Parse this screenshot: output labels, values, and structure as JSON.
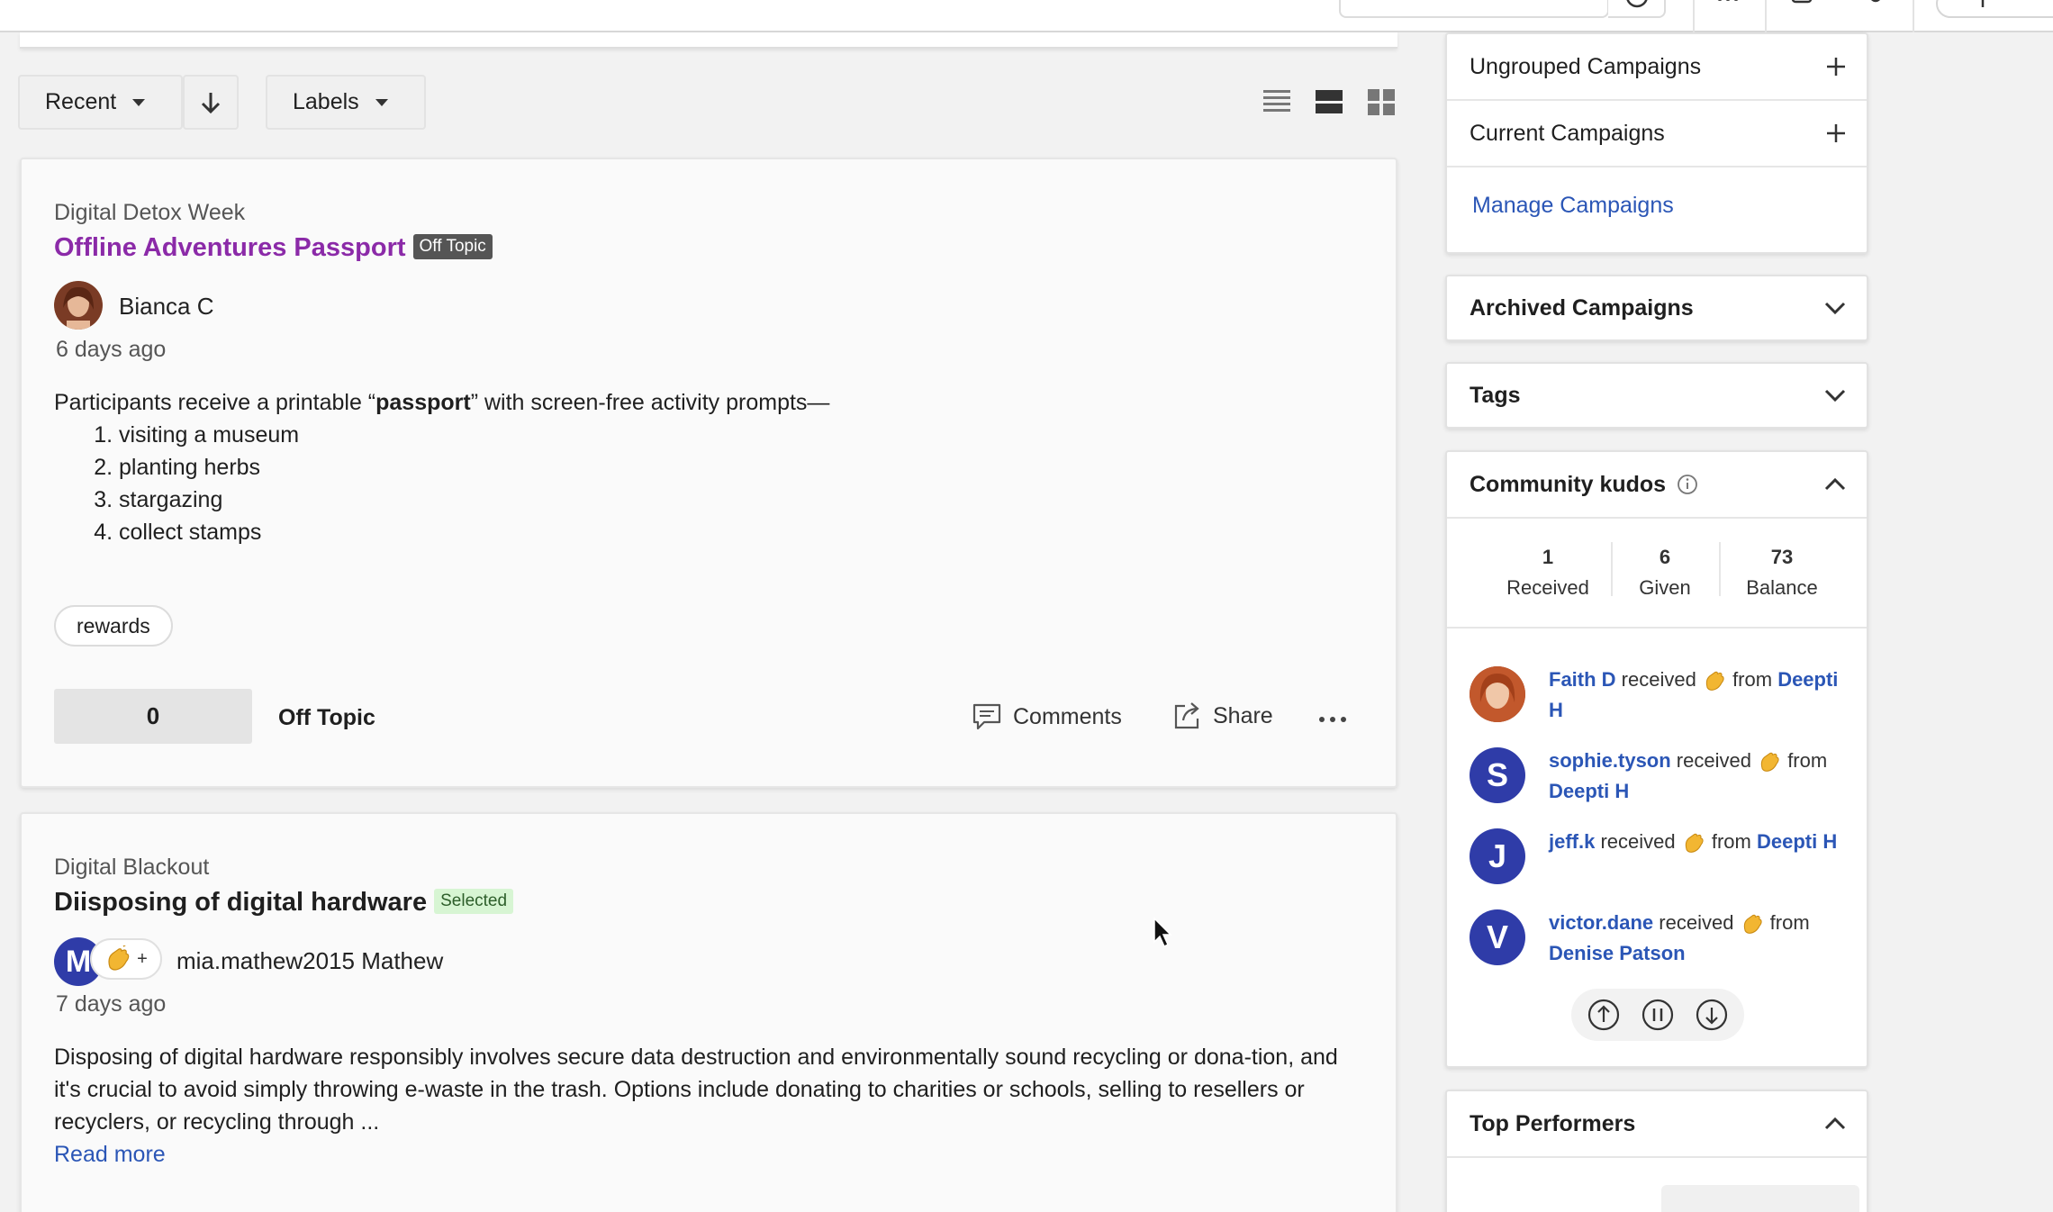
{
  "toolbar": {
    "sort_label": "Recent",
    "labels_label": "Labels"
  },
  "posts": [
    {
      "campaign": "Digital Detox Week",
      "title": "Offline Adventures Passport",
      "badge": "Off Topic",
      "title_color": "#8b2aa8",
      "author": "Bianca C",
      "time": "6 days ago",
      "intro_before": "Participants receive a printable “",
      "intro_bold": "passport",
      "intro_after": "” with screen-free activity prompts—",
      "list": [
        "visiting a museum",
        "planting herbs",
        "stargazing",
        "collect stamps"
      ],
      "tag": "rewards",
      "votes": "0",
      "status": "Off Topic",
      "comments_label": "Comments",
      "share_label": "Share"
    },
    {
      "campaign": "Digital Blackout",
      "title": "Diisposing of digital hardware",
      "badge": "Selected",
      "author": "mia.mathew2015 Mathew",
      "avatar_letter": "M",
      "reaction_plus": "+",
      "time": "7 days ago",
      "body": "Disposing of digital hardware responsibly involves secure data destruction and environmentally sound recycling or dona-tion, and it's crucial to avoid simply throwing e-waste in the trash. Options include donating to charities or schools, selling to resellers or recyclers, or recycling through ...",
      "read_more": "Read more"
    }
  ],
  "sidebar": {
    "ungrouped": "Ungrouped Campaigns",
    "current": "Current Campaigns",
    "manage": "Manage Campaigns",
    "archived": "Archived Campaigns",
    "tags": "Tags",
    "kudos_title": "Community kudos",
    "stats": [
      {
        "num": "1",
        "label": "Received"
      },
      {
        "num": "6",
        "label": "Given"
      },
      {
        "num": "73",
        "label": "Balance"
      }
    ],
    "kudos": [
      {
        "user": "Faith D",
        "verb": " received ",
        "from_word": " from ",
        "from": "Deepti H"
      },
      {
        "user": "sophie.tyson",
        "verb": " received ",
        "from_word": " from ",
        "from": "Deepti H",
        "letter": "S"
      },
      {
        "user": "jeff.k",
        "verb": " received ",
        "from_word": " from ",
        "from": "Deepti H",
        "letter": "J"
      },
      {
        "user": "victor.dane",
        "verb": " received ",
        "from_word": " from ",
        "from": "Denise Patson",
        "letter": "V"
      }
    ],
    "top_performers": "Top Performers"
  },
  "colors": {
    "accent_blue": "#2b56b6",
    "avatar_blue": "#2f3ca8",
    "title_purple": "#8b2aa8"
  }
}
